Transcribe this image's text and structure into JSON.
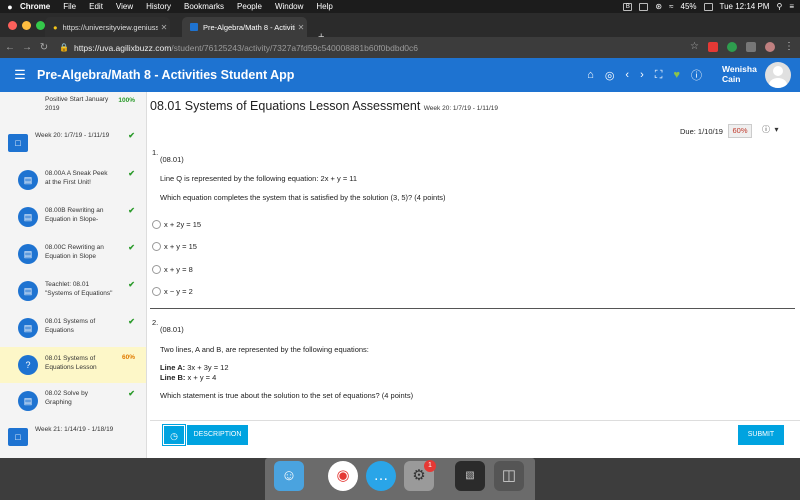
{
  "menubar": {
    "apple": "",
    "items": [
      "Chrome",
      "File",
      "Edit",
      "View",
      "History",
      "Bookmarks",
      "People",
      "Window",
      "Help"
    ],
    "battery": "45%",
    "clock": "Tue 12:14 PM"
  },
  "browser": {
    "tabs": [
      {
        "label": "https://universityview.geniussis",
        "close": "✕"
      },
      {
        "label": "Pre-Algebra/Math 8 - Activities",
        "close": "✕"
      }
    ],
    "new_tab": "+",
    "url_host": "https://uva.agilixbuzz.com",
    "url_path": "/student/76125243/activity/7327a7fd59c540008881b60f0bdbd0c6"
  },
  "app": {
    "title": "Pre-Algebra/Math 8 - Activities Student App",
    "user_first": "Wenisha",
    "user_last": "Cain"
  },
  "sidebar": {
    "items": [
      {
        "label": "Positive Start January 2019",
        "status": "100%"
      },
      {
        "label": "Week 20: 1/7/19 - 1/11/19",
        "status": "✔"
      },
      {
        "label": "08.00A A Sneak Peek at the First Unit!",
        "status": "✔"
      },
      {
        "label": "08.00B Rewriting an Equation in Slope-",
        "status": "✔"
      },
      {
        "label": "08.00C Rewriting an Equation in Slope",
        "status": "✔"
      },
      {
        "label": "Teachlet: 08.01 \"Systems of Equations\"",
        "status": "✔"
      },
      {
        "label": "08.01 Systems of Equations",
        "status": "✔"
      },
      {
        "label": "08.01 Systems of Equations Lesson",
        "status": "60%"
      },
      {
        "label": "08.02 Solve by Graphing",
        "status": "✔"
      },
      {
        "label": "Week 21: 1/14/19 - 1/18/19",
        "status": ""
      }
    ]
  },
  "lesson": {
    "title": "08.01 Systems of Equations Lesson Assessment",
    "week": "Week 20: 1/7/19 - 1/11/19",
    "due": "Due: 1/10/19",
    "score": "60%"
  },
  "question1": {
    "number": "1.",
    "code": "(08.01)",
    "text1": "Line Q is represented by the following equation: 2x + y = 11",
    "text2": "Which equation completes the system that is satisfied by the solution (3, 5)? (4 points)",
    "options": [
      "x + 2y = 15",
      "x + y = 15",
      "x + y = 8",
      "x − y = 2"
    ]
  },
  "question2": {
    "number": "2.",
    "code": "(08.01)",
    "text1": "Two lines, A and B, are represented by the following equations:",
    "lineA_label": "Line A:",
    "lineA_eq": "3x + 3y = 12",
    "lineB_label": "Line B:",
    "lineB_eq": "x + y = 4",
    "text2": "Which statement is true about the solution to the set of equations? (4 points)"
  },
  "bottom": {
    "description": "DESCRIPTION",
    "submit": "SUBMIT"
  },
  "dock": {
    "badge": "1"
  }
}
